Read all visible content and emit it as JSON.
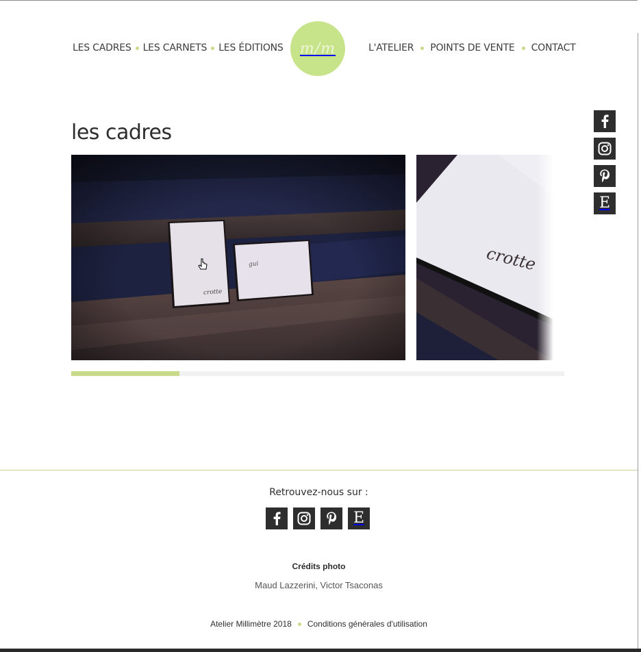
{
  "nav": {
    "left": [
      "LES CADRES",
      "LES CARNETS",
      "LES ÉDITIONS"
    ],
    "right": [
      "L'ATELIER",
      "POINTS DE VENTE",
      "CONTACT"
    ]
  },
  "logo": {
    "text": "m/m"
  },
  "page": {
    "title": "les cadres"
  },
  "carousel": {
    "slides": [
      {
        "card_large_text": "crotte",
        "card_small_text": "gui"
      },
      {
        "card_text": "crotte"
      }
    ],
    "scroll_progress": 0.22
  },
  "social": {
    "items": [
      {
        "name": "facebook",
        "glyph": "f"
      },
      {
        "name": "instagram",
        "glyph": ""
      },
      {
        "name": "pinterest",
        "glyph": "P"
      },
      {
        "name": "etsy",
        "glyph": "E"
      }
    ]
  },
  "footer": {
    "heading": "Retrouvez-nous sur :",
    "credits_title": "Crédits photo",
    "credits_names": "Maud Lazzerini, Victor Tsaconas",
    "copyright": "Atelier Millimètre 2018",
    "terms": "Conditions générales d'utilisation"
  },
  "colors": {
    "accent": "#c8d98a",
    "logo_bg": "#c8e48a",
    "icon_bg": "#2e2e2e",
    "text": "#333333"
  }
}
